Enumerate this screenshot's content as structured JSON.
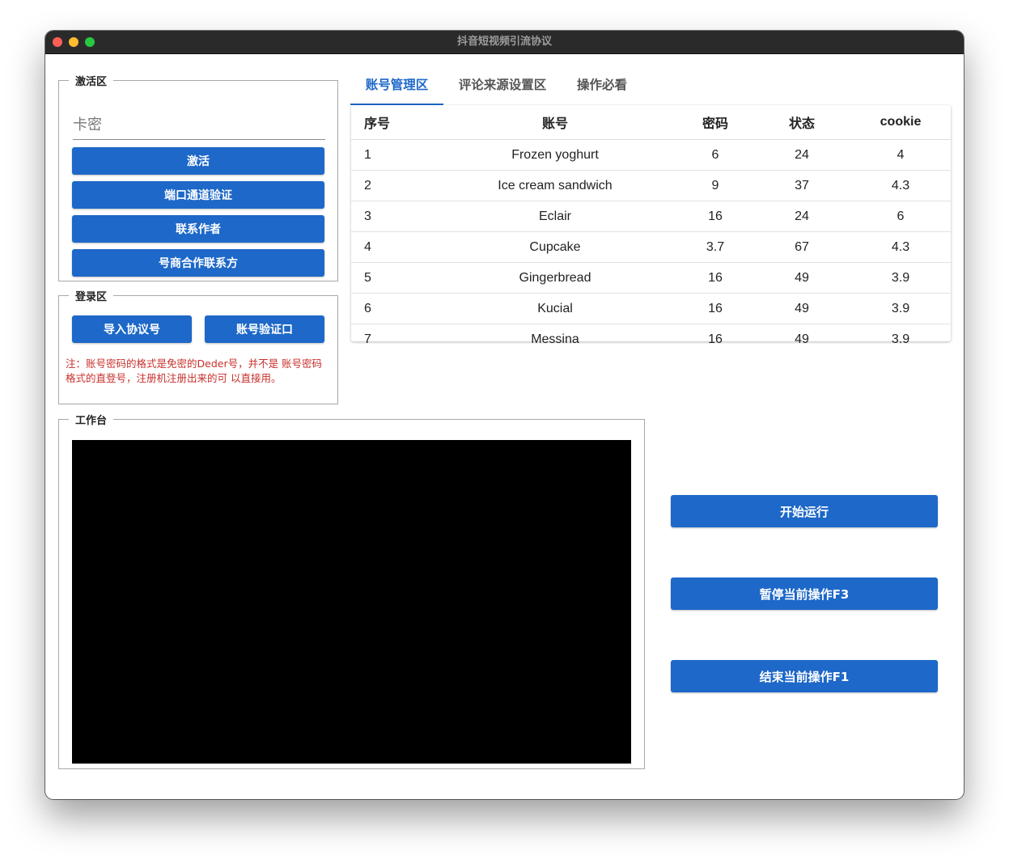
{
  "window": {
    "title": "抖音短视频引流协议"
  },
  "activation": {
    "legend": "激活区",
    "card_placeholder": "卡密",
    "buttons": [
      "激活",
      "端口通道验证",
      "联系作者",
      "号商合作联系方"
    ]
  },
  "login": {
    "legend": "登录区",
    "import_label": "导入协议号",
    "verify_label": "账号验证口",
    "note": "注：账号密码的格式是免密的Deder号，并不是 账号密码格式的直登号，注册机注册出来的可 以直接用。"
  },
  "tabs": [
    {
      "label": "账号管理区",
      "active": true
    },
    {
      "label": "评论来源设置区",
      "active": false
    },
    {
      "label": "操作必看",
      "active": false
    }
  ],
  "table": {
    "headers": [
      "序号",
      "账号",
      "密码",
      "状态",
      "cookie"
    ],
    "rows": [
      [
        "1",
        "Frozen yoghurt",
        "6",
        "24",
        "4"
      ],
      [
        "2",
        "Ice cream sandwich",
        "9",
        "37",
        "4.3"
      ],
      [
        "3",
        "Eclair",
        "16",
        "24",
        "6"
      ],
      [
        "4",
        "Cupcake",
        "3.7",
        "67",
        "4.3"
      ],
      [
        "5",
        "Gingerbread",
        "16",
        "49",
        "3.9"
      ],
      [
        "6",
        "Kucial",
        "16",
        "49",
        "3.9"
      ],
      [
        "7",
        "Messina",
        "16",
        "49",
        "3.9"
      ]
    ]
  },
  "workbench": {
    "legend": "工作台"
  },
  "actions": {
    "start": "开始运行",
    "pause": "暂停当前操作F3",
    "stop": "结束当前操作F1"
  },
  "colors": {
    "accent": "#1d68c8",
    "note": "#c8302c",
    "titlebar": "#2b2a2b"
  }
}
